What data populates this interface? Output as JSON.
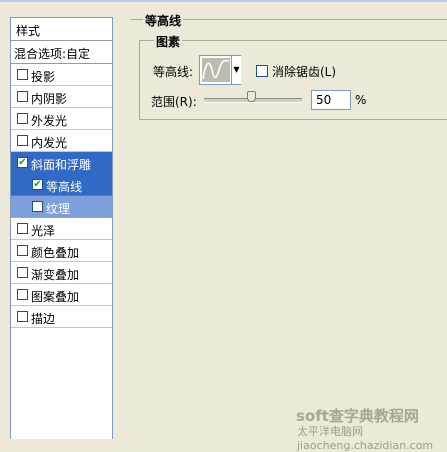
{
  "styles_panel": {
    "header": "样式",
    "blend_options": "混合选项:自定",
    "items": [
      {
        "label": "投影",
        "checked": false
      },
      {
        "label": "内阴影",
        "checked": false
      },
      {
        "label": "外发光",
        "checked": false
      },
      {
        "label": "内发光",
        "checked": false
      },
      {
        "label": "斜面和浮雕",
        "checked": true,
        "state": "selected-parent"
      },
      {
        "label": "等高线",
        "checked": true,
        "state": "selected"
      },
      {
        "label": "纹理",
        "checked": false,
        "state": "sub"
      },
      {
        "label": "光泽",
        "checked": false
      },
      {
        "label": "颜色叠加",
        "checked": false
      },
      {
        "label": "渐变叠加",
        "checked": false
      },
      {
        "label": "图案叠加",
        "checked": false
      },
      {
        "label": "描边",
        "checked": false
      }
    ]
  },
  "contour_section": {
    "title": "等高线",
    "group_title": "图素",
    "contour_label": "等高线:",
    "anti_alias_label": "消除锯齿(L)",
    "anti_alias_checked": false,
    "range_label": "范围(R):",
    "range_value": "50",
    "range_unit": "%"
  },
  "watermark": {
    "line1": "soft查字典教程网",
    "line2": "太平洋电脑网 jiaocheng.chazidian.com"
  }
}
